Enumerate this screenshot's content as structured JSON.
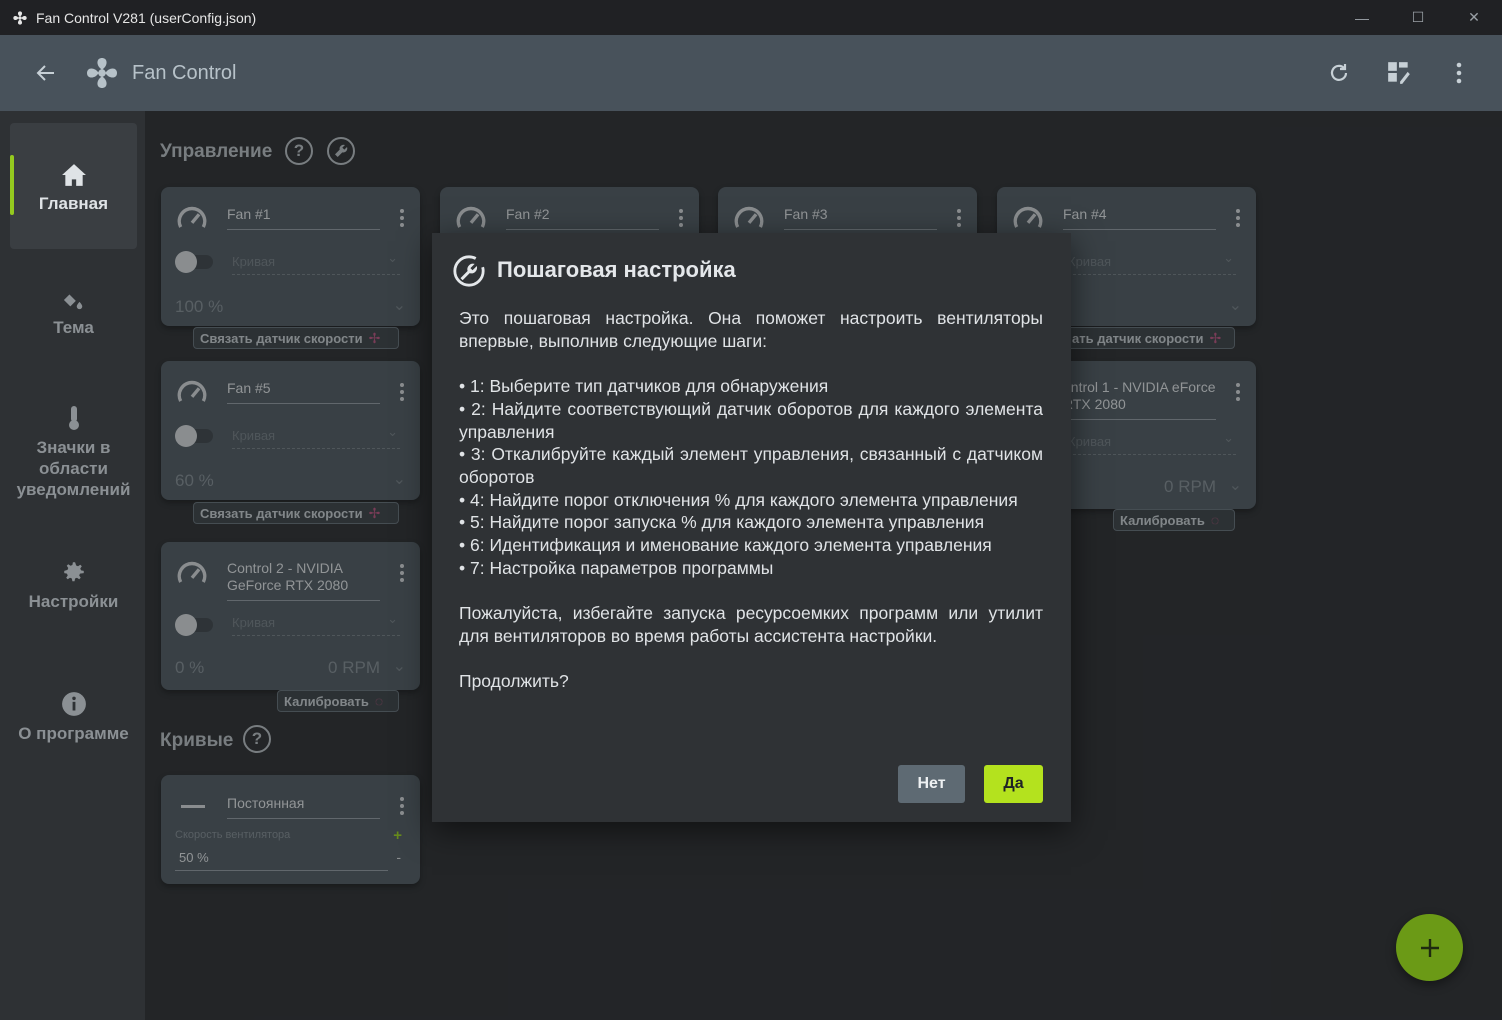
{
  "window": {
    "title": "Fan Control V281 (userConfig.json)",
    "controls": [
      "minimize-icon",
      "maximize-icon",
      "close-icon"
    ]
  },
  "header": {
    "app_name": "Fan Control",
    "icons": [
      "back-arrow-icon",
      "fan-logo-icon",
      "refresh-icon",
      "dashboard-icon",
      "more-vert-icon"
    ]
  },
  "sidebar": {
    "items": [
      {
        "label": "Главная",
        "icon": "home-icon",
        "active": true
      },
      {
        "label": "Тема",
        "icon": "paint-bucket-icon"
      },
      {
        "label": "Значки в области уведомлений",
        "icon": "thermometer-icon"
      },
      {
        "label": "Настройки",
        "icon": "gear-icon"
      },
      {
        "label": "О программе",
        "icon": "info-icon"
      }
    ]
  },
  "controls_section": {
    "title": "Управление",
    "cards": [
      {
        "name": "Fan #1",
        "curve": "Кривая",
        "percent": "100 %",
        "rpm": "",
        "action": "Связать датчик скорости"
      },
      {
        "name": "Fan #2"
      },
      {
        "name": "Fan #3"
      },
      {
        "name": "Fan #4",
        "curve": "Кривая",
        "action": "ать датчик скорости"
      },
      {
        "name": "Fan #5",
        "curve": "Кривая",
        "percent": "60 %",
        "action": "Связать датчик скорости"
      },
      {
        "name": "Control 2 - NVIDIA GeForce RTX 2080",
        "curve": "Кривая",
        "percent": "0 %",
        "rpm": "0 RPM",
        "action": "Калибровать"
      },
      {
        "name": "ontrol 1 - NVIDIA eForce RTX 2080",
        "curve": "Кривая",
        "rpm": "0 RPM",
        "action": "Калибровать"
      }
    ]
  },
  "curves_section": {
    "title": "Кривые",
    "card": {
      "name": "Постоянная",
      "field_label": "Скорость вентилятора",
      "value": "50 %",
      "plus": "+",
      "minus": "-"
    }
  },
  "dialog": {
    "title": "Пошаговая настройка",
    "intro": "Это пошаговая настройка. Она поможет настроить вентиляторы впервые, выполнив следующие шаги:",
    "steps": [
      "• 1: Выберите тип датчиков для обнаружения",
      "• 2: Найдите соответствующий датчик оборотов для каждого элемента управления",
      "• 3: Откалибруйте каждый элемент управления, связанный с датчиком оборотов",
      "• 4: Найдите порог отключения % для каждого элемента управления",
      "• 5: Найдите порог запуска % для каждого элемента управления",
      "• 6: Идентификация и именование каждого элемента управления",
      "• 7: Настройка параметров программы"
    ],
    "warning": "Пожалуйста, избегайте запуска ресурсоемких программ или утилит для вентиляторов во время работы ассистента настройки.",
    "question": "Продолжить?",
    "no_label": "Нет",
    "yes_label": "Да"
  },
  "fab": {
    "symbol": "+"
  },
  "colors": {
    "accent": "#b4e21e",
    "fab": "#6b9a16",
    "header": "#48525b",
    "card": "#4d565e"
  }
}
